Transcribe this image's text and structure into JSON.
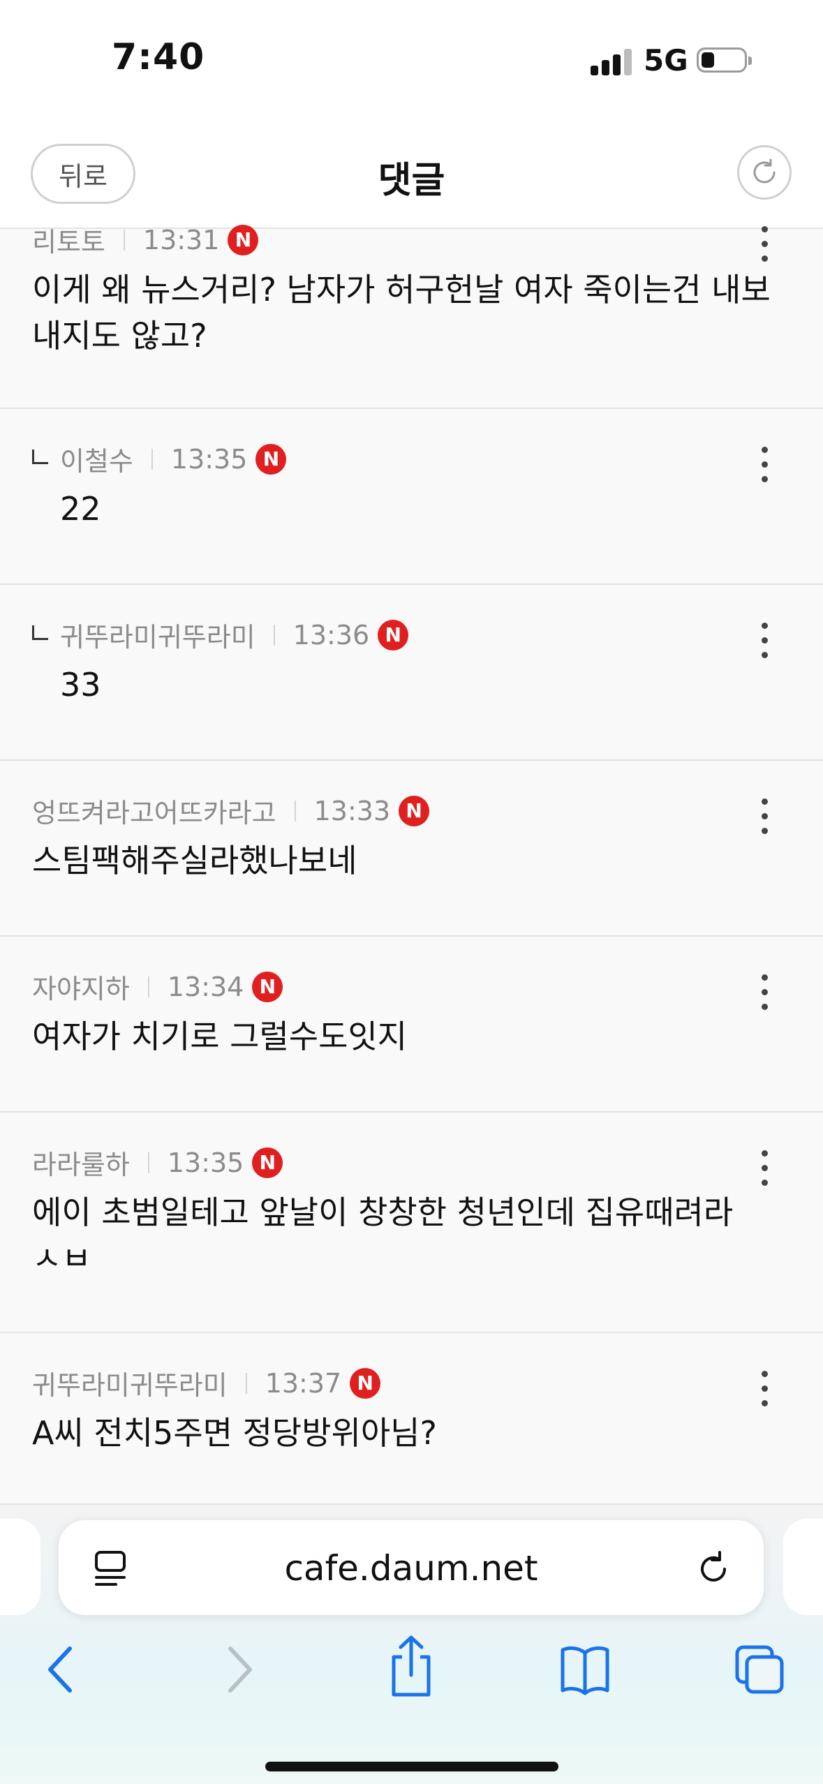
{
  "status_bar": {
    "time": "7:40",
    "network": "5G"
  },
  "header": {
    "back_label": "뒤로",
    "title": "댓글"
  },
  "comments": [
    {
      "author": "리토토",
      "time": "13:31",
      "badge": "N",
      "lines": [
        "이게 왜 뉴스거리? 남자가 허구헌날 여자 죽이는건 내보",
        "내지도 않고?"
      ]
    },
    {
      "author": "이철수",
      "time": "13:35",
      "badge": "N",
      "lines": [
        "22"
      ]
    },
    {
      "author": "귀뚜라미귀뚜라미",
      "time": "13:36",
      "badge": "N",
      "lines": [
        "33"
      ]
    },
    {
      "author": "엉뜨켜라고어뜨카라고",
      "time": "13:33",
      "badge": "N",
      "lines": [
        "스팀팩해주실라했나보네"
      ]
    },
    {
      "author": "자야지하",
      "time": "13:34",
      "badge": "N",
      "lines": [
        "여자가 치기로 그럴수도잇지"
      ]
    },
    {
      "author": "라라룰하",
      "time": "13:35",
      "badge": "N",
      "lines": [
        "에이 초범일테고 앞날이 창창한 청년인데 집유때려라",
        "ㅅㅂ"
      ]
    },
    {
      "author": "귀뚜라미귀뚜라미",
      "time": "13:37",
      "badge": "N",
      "lines": [
        "A씨 전치5주면 정당방위아님?"
      ]
    }
  ],
  "browser": {
    "url": "cafe.daum.net"
  },
  "icons": {
    "reader": "reader-icon",
    "reload": "reload-icon",
    "back": "back-icon",
    "forward": "forward-icon",
    "share": "share-icon",
    "bookmarks": "bookmarks-icon",
    "tabs": "tabs-icon"
  },
  "colors": {
    "badge": "#e02020",
    "accent": "#1a73e8"
  }
}
